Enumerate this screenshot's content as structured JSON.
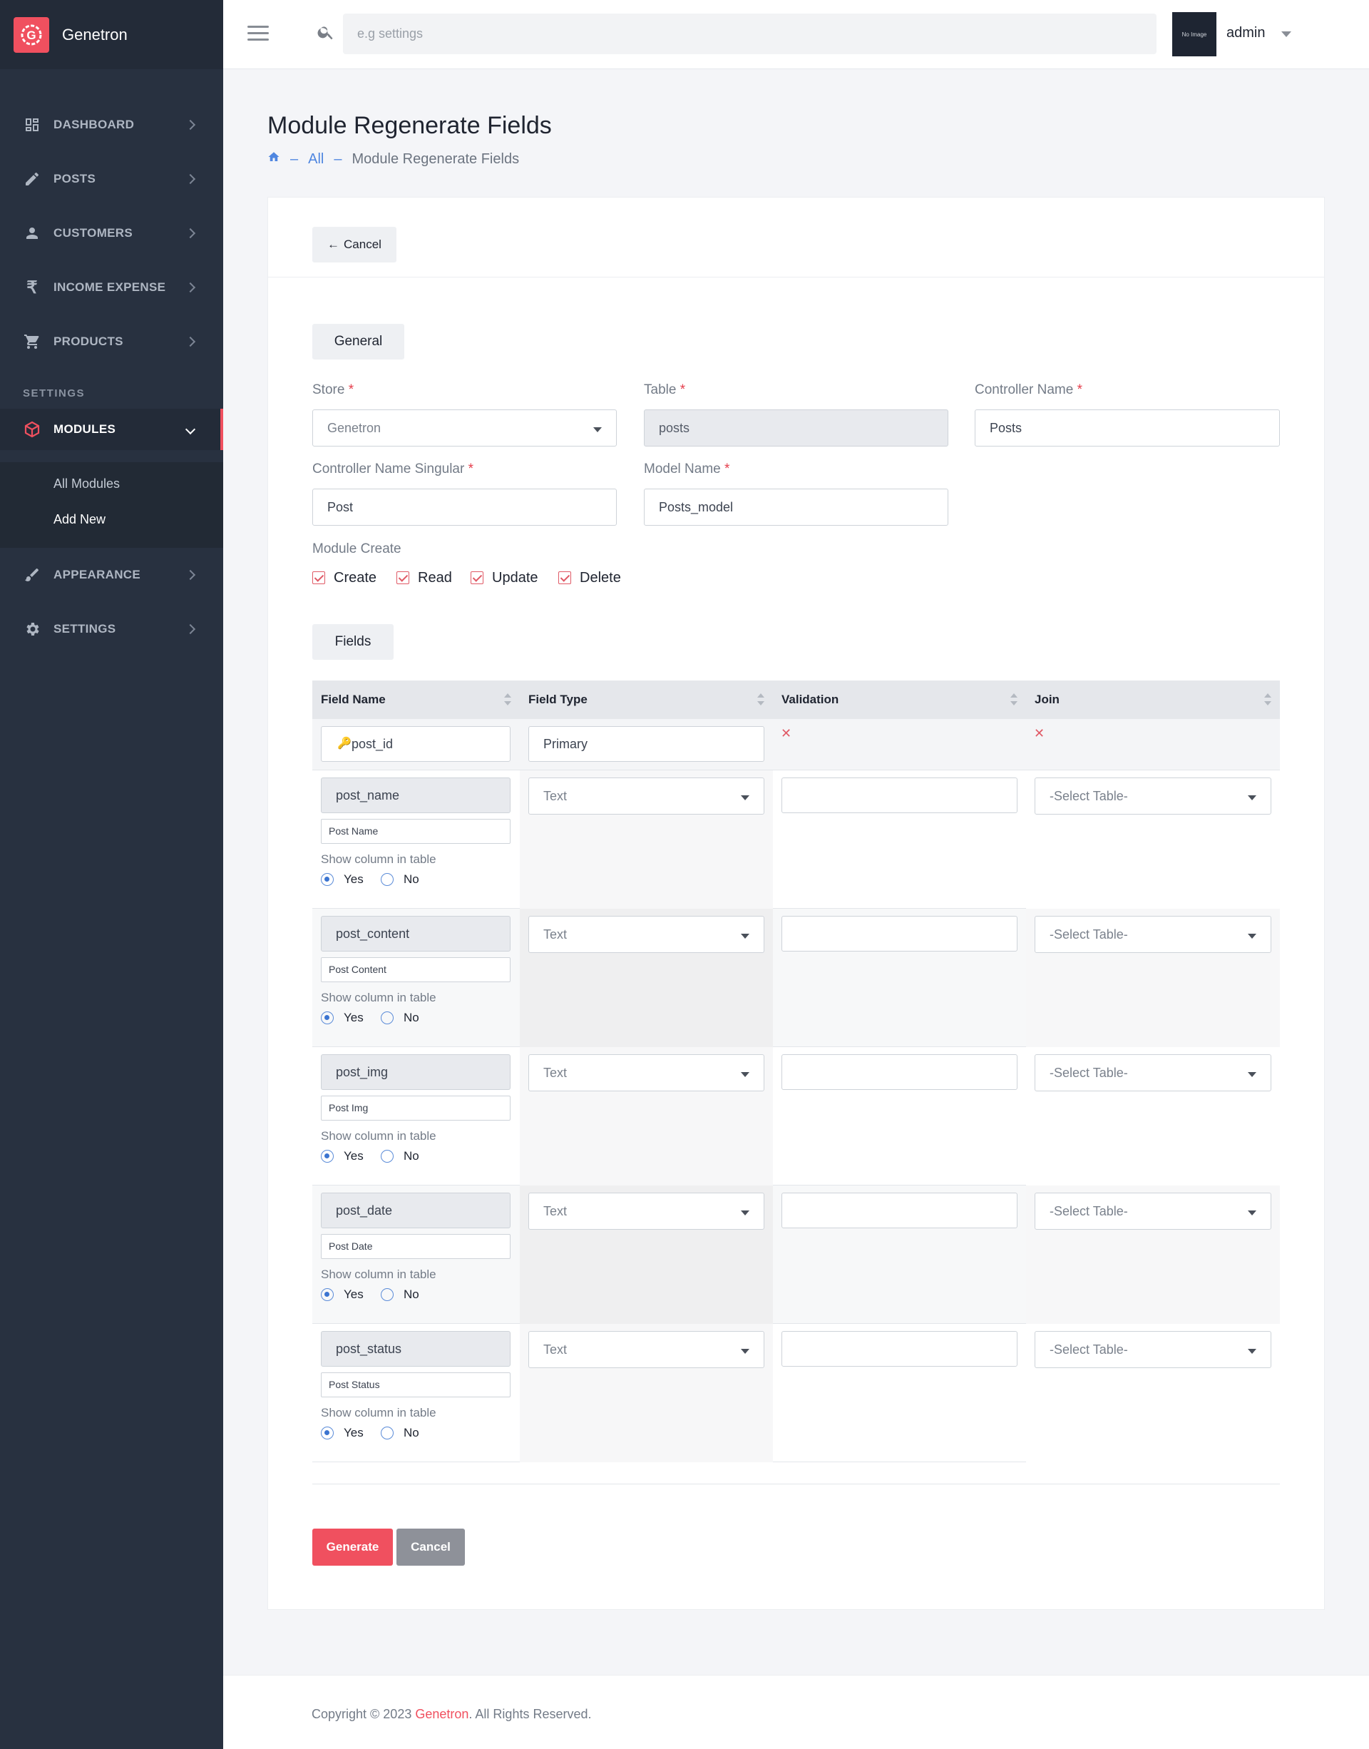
{
  "brand": {
    "name": "Genetron",
    "logo_letter": "G",
    "accent": "#f0505f"
  },
  "sidebar": {
    "items": [
      {
        "label": "DASHBOARD",
        "icon": "dashboard-icon"
      },
      {
        "label": "POSTS",
        "icon": "pencil-icon"
      },
      {
        "label": "CUSTOMERS",
        "icon": "person-icon"
      },
      {
        "label": "INCOME EXPENSE",
        "icon": "rupee-icon"
      },
      {
        "label": "PRODUCTS",
        "icon": "cart-icon"
      }
    ],
    "section": "SETTINGS",
    "active": {
      "label": "MODULES",
      "icon": "cube-icon"
    },
    "submenu": [
      "All Modules",
      "Add New"
    ],
    "bottom": [
      {
        "label": "APPEARANCE",
        "icon": "brush-icon"
      },
      {
        "label": "SETTINGS",
        "icon": "gear-icon"
      }
    ]
  },
  "topbar": {
    "search_placeholder": "e.g settings",
    "avatar_text": "No Image",
    "user": "admin"
  },
  "page": {
    "title": "Module Regenerate Fields",
    "breadcrumb": {
      "all": "All",
      "current": "Module Regenerate Fields",
      "sep": "–"
    }
  },
  "card": {
    "cancel_top": "Cancel",
    "general_tab": "General",
    "store": {
      "label": "Store",
      "value": "Genetron"
    },
    "table": {
      "label": "Table",
      "value": "posts"
    },
    "controller": {
      "label": "Controller Name",
      "value": "Posts"
    },
    "controller_singular": {
      "label": "Controller Name Singular",
      "value": "Post"
    },
    "model": {
      "label": "Model Name",
      "value": "Posts_model"
    },
    "module_create": {
      "label": "Module Create",
      "options": [
        "Create",
        "Read",
        "Update",
        "Delete"
      ]
    },
    "fields_tab": "Fields",
    "table_headers": [
      "Field Name",
      "Field Type",
      "Validation",
      "Join"
    ],
    "primary": {
      "name": "post_id",
      "type": "Primary"
    },
    "rows": [
      {
        "name": "post_name",
        "title": "Post Name",
        "type": "Text",
        "join": "-Select Table-"
      },
      {
        "name": "post_content",
        "title": "Post Content",
        "type": "Text",
        "join": "-Select Table-"
      },
      {
        "name": "post_img",
        "title": "Post Img",
        "type": "Text",
        "join": "-Select Table-"
      },
      {
        "name": "post_date",
        "title": "Post Date",
        "type": "Text",
        "join": "-Select Table-"
      },
      {
        "name": "post_status",
        "title": "Post Status",
        "type": "Text",
        "join": "-Select Table-"
      }
    ],
    "show_column_label": "Show column in table",
    "yes": "Yes",
    "no": "No",
    "generate": "Generate",
    "cancel": "Cancel"
  },
  "footer": {
    "pre": "Copyright © 2023 ",
    "brand": "Genetron",
    "post": ". All Rights Reserved."
  }
}
